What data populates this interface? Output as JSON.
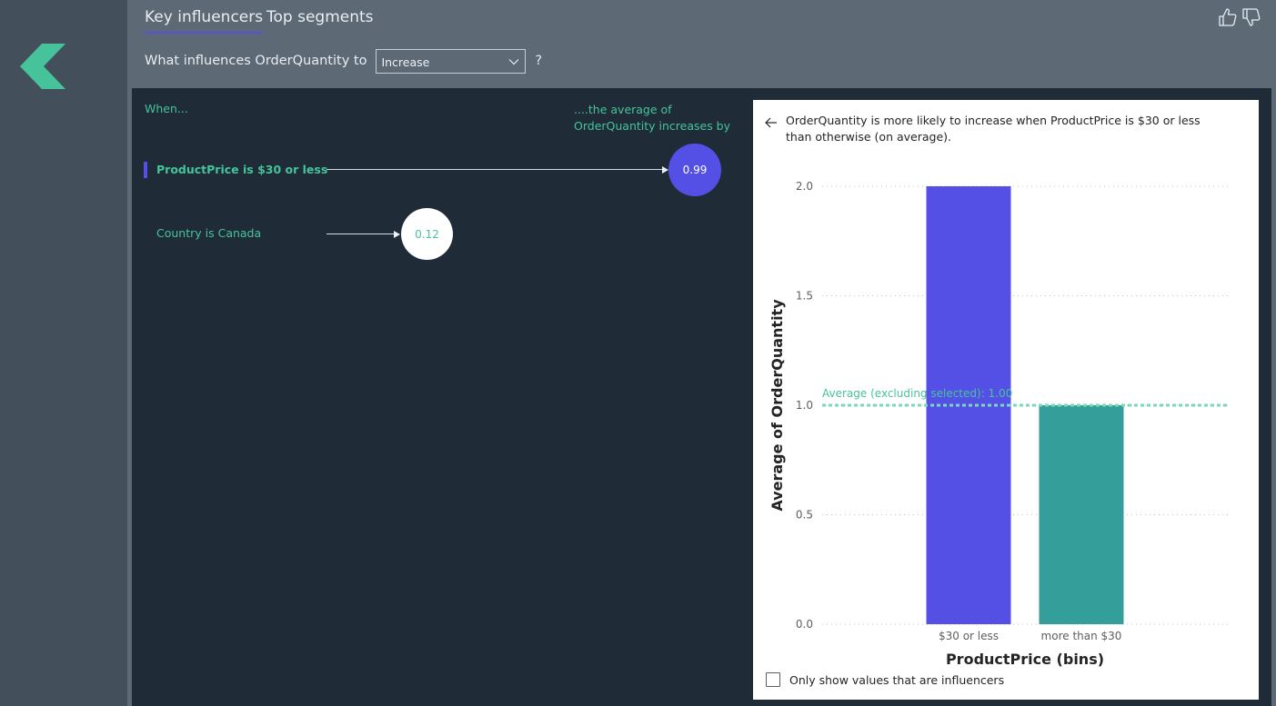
{
  "nav": {
    "back_icon": "chevron-left-icon"
  },
  "tabs": [
    {
      "label": "Key influencers",
      "active": true
    },
    {
      "label": "Top segments",
      "active": false
    }
  ],
  "feedback": {
    "like_icon": "thumbs-up-icon",
    "dislike_icon": "thumbs-down-icon"
  },
  "question": {
    "prefix": "What influences OrderQuantity to",
    "dropdown_value": "Increase",
    "suffix": "?"
  },
  "influencers": {
    "when_label": "When...",
    "avg_label_line1": "....the average of",
    "avg_label_line2": "OrderQuantity increases by",
    "items": [
      {
        "label": "ProductPrice is $30 or less",
        "value": "0.99",
        "selected": true
      },
      {
        "label": "Country is Canada",
        "value": "0.12",
        "selected": false
      }
    ]
  },
  "detail": {
    "description": "OrderQuantity is more likely to increase when ProductPrice is $30 or less than otherwise (on average).",
    "checkbox_label": "Only show values that are influencers"
  },
  "colors": {
    "accent": "#5450e6",
    "teal_bar": "#339e9a",
    "green_text": "#46c39a",
    "panel_bg": "#1f2c38"
  },
  "chart_data": {
    "type": "bar",
    "categories": [
      "$30 or less",
      "more than $30"
    ],
    "values": [
      2.0,
      1.0
    ],
    "bar_colors": [
      "#5450e6",
      "#339e9a"
    ],
    "xlabel": "ProductPrice (bins)",
    "ylabel": "Average of OrderQuantity",
    "ylim": [
      0,
      2.0
    ],
    "yticks": [
      "0.0",
      "0.5",
      "1.0",
      "1.5",
      "2.0"
    ],
    "ytick_values": [
      0,
      0.5,
      1.0,
      1.5,
      2.0
    ],
    "reference_line": {
      "value": 1.0,
      "label": "Average (excluding selected): 1.00",
      "color": "#79d9b9"
    },
    "grid": true
  }
}
